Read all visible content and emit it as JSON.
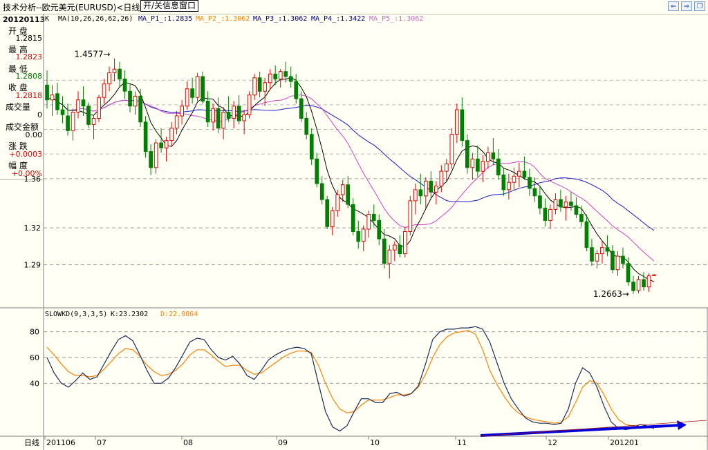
{
  "window": {
    "title": "技术分析--欧元美元(EURUSD)<日线>",
    "toggle_info_button": "开/关信息窗口"
  },
  "sidebar": {
    "date": "20120113",
    "rows": [
      {
        "label": "开  盘",
        "value": "1.2815",
        "color": "#000000"
      },
      {
        "label": "最  高",
        "value": "1.2823",
        "color": "#e60000"
      },
      {
        "label": "最  低",
        "value": "1.2808",
        "color": "#008000"
      },
      {
        "label": "收  盘",
        "value": "1.2818",
        "color": "#e60000"
      },
      {
        "label": "成交量",
        "value": "0",
        "color": "#000000"
      },
      {
        "label": "成交金额",
        "value": "0.00",
        "color": "#000000"
      },
      {
        "label": "涨  跌",
        "value": "+0.0003",
        "color": "#e60000"
      },
      {
        "label": "幅  度",
        "value": "+0.00%",
        "color": "#e60000"
      }
    ]
  },
  "main_legend": {
    "k": "K",
    "ma_params": "MA(10,26,26,62,26)",
    "items": [
      {
        "text": "MA_P1_:1.2835",
        "color": "#000080"
      },
      {
        "text": "MA_P2_:1.3062",
        "color": "#ff8000"
      },
      {
        "text": "MA_P3_:1.3062",
        "color": "#000080"
      },
      {
        "text": "MA_P4_:1.3422",
        "color": "#000080"
      },
      {
        "text": "MA_P5_:1.3062",
        "color": "#cc66cc"
      }
    ]
  },
  "kd_legend": {
    "name": "SLOWKD(9,3,3,5)",
    "k": "K:23.2302",
    "d": "D:22.0864"
  },
  "colors": {
    "up": "#e60000",
    "down": "#008000",
    "ma10": "#000000",
    "ma26_slow": "#1a1acc",
    "ma62_violet": "#cc44cc",
    "k_line": "#1a2a5a",
    "d_line": "#ff8000",
    "trend_arrow": "#0000dd"
  },
  "chart_data": [
    {
      "type": "candlestick",
      "ylabel_ticks": [
        "1.36",
        "1.32",
        "1.29"
      ],
      "ylim": [
        1.255,
        1.485
      ],
      "annotations": [
        {
          "text": "1.4577",
          "value": 1.4577,
          "label": "high"
        },
        {
          "text": "1.2663",
          "value": 1.2663,
          "label": "low"
        }
      ],
      "ohlc": [
        [
          1.436,
          1.448,
          1.417,
          1.424
        ],
        [
          1.424,
          1.436,
          1.411,
          1.428
        ],
        [
          1.429,
          1.438,
          1.412,
          1.416
        ],
        [
          1.416,
          1.427,
          1.405,
          1.412
        ],
        [
          1.411,
          1.421,
          1.395,
          1.399
        ],
        [
          1.399,
          1.417,
          1.391,
          1.414
        ],
        [
          1.414,
          1.431,
          1.409,
          1.424
        ],
        [
          1.424,
          1.435,
          1.411,
          1.419
        ],
        [
          1.419,
          1.422,
          1.401,
          1.404
        ],
        [
          1.404,
          1.412,
          1.392,
          1.409
        ],
        [
          1.409,
          1.428,
          1.406,
          1.426
        ],
        [
          1.426,
          1.441,
          1.421,
          1.437
        ],
        [
          1.437,
          1.451,
          1.431,
          1.446
        ],
        [
          1.446,
          1.4577,
          1.439,
          1.449
        ],
        [
          1.449,
          1.455,
          1.434,
          1.441
        ],
        [
          1.441,
          1.448,
          1.425,
          1.431
        ],
        [
          1.431,
          1.437,
          1.414,
          1.419
        ],
        [
          1.419,
          1.431,
          1.412,
          1.427
        ],
        [
          1.427,
          1.433,
          1.402,
          1.406
        ],
        [
          1.406,
          1.411,
          1.377,
          1.382
        ],
        [
          1.382,
          1.388,
          1.363,
          1.369
        ],
        [
          1.369,
          1.392,
          1.364,
          1.389
        ],
        [
          1.389,
          1.401,
          1.381,
          1.385
        ],
        [
          1.385,
          1.394,
          1.374,
          1.391
        ],
        [
          1.391,
          1.406,
          1.386,
          1.401
        ],
        [
          1.401,
          1.415,
          1.396,
          1.411
        ],
        [
          1.411,
          1.424,
          1.404,
          1.419
        ],
        [
          1.419,
          1.439,
          1.416,
          1.433
        ],
        [
          1.433,
          1.442,
          1.421,
          1.426
        ],
        [
          1.426,
          1.446,
          1.423,
          1.443
        ],
        [
          1.443,
          1.447,
          1.421,
          1.423
        ],
        [
          1.423,
          1.431,
          1.402,
          1.406
        ],
        [
          1.406,
          1.421,
          1.399,
          1.417
        ],
        [
          1.417,
          1.426,
          1.397,
          1.401
        ],
        [
          1.401,
          1.418,
          1.392,
          1.414
        ],
        [
          1.414,
          1.427,
          1.406,
          1.409
        ],
        [
          1.409,
          1.423,
          1.401,
          1.419
        ],
        [
          1.419,
          1.428,
          1.404,
          1.407
        ],
        [
          1.407,
          1.416,
          1.396,
          1.412
        ],
        [
          1.412,
          1.431,
          1.409,
          1.428
        ],
        [
          1.428,
          1.445,
          1.424,
          1.442
        ],
        [
          1.442,
          1.447,
          1.426,
          1.431
        ],
        [
          1.431,
          1.442,
          1.419,
          1.438
        ],
        [
          1.438,
          1.449,
          1.432,
          1.445
        ],
        [
          1.445,
          1.452,
          1.436,
          1.441
        ],
        [
          1.441,
          1.449,
          1.434,
          1.447
        ],
        [
          1.447,
          1.455,
          1.438,
          1.443
        ],
        [
          1.443,
          1.451,
          1.434,
          1.439
        ],
        [
          1.439,
          1.445,
          1.421,
          1.425
        ],
        [
          1.425,
          1.431,
          1.406,
          1.409
        ],
        [
          1.409,
          1.414,
          1.392,
          1.396
        ],
        [
          1.396,
          1.401,
          1.371,
          1.376
        ],
        [
          1.376,
          1.381,
          1.353,
          1.356
        ],
        [
          1.356,
          1.362,
          1.339,
          1.343
        ],
        [
          1.343,
          1.346,
          1.319,
          1.321
        ],
        [
          1.321,
          1.337,
          1.314,
          1.334
        ],
        [
          1.334,
          1.351,
          1.329,
          1.347
        ],
        [
          1.347,
          1.359,
          1.341,
          1.355
        ],
        [
          1.355,
          1.362,
          1.336,
          1.339
        ],
        [
          1.339,
          1.344,
          1.314,
          1.317
        ],
        [
          1.317,
          1.326,
          1.303,
          1.309
        ],
        [
          1.309,
          1.322,
          1.301,
          1.319
        ],
        [
          1.319,
          1.334,
          1.312,
          1.331
        ],
        [
          1.331,
          1.339,
          1.321,
          1.326
        ],
        [
          1.326,
          1.331,
          1.306,
          1.311
        ],
        [
          1.311,
          1.319,
          1.287,
          1.291
        ],
        [
          1.291,
          1.306,
          1.279,
          1.302
        ],
        [
          1.302,
          1.309,
          1.293,
          1.306
        ],
        [
          1.306,
          1.314,
          1.296,
          1.299
        ],
        [
          1.299,
          1.321,
          1.296,
          1.317
        ],
        [
          1.317,
          1.346,
          1.314,
          1.342
        ],
        [
          1.342,
          1.356,
          1.331,
          1.351
        ],
        [
          1.351,
          1.364,
          1.339,
          1.346
        ],
        [
          1.346,
          1.361,
          1.336,
          1.358
        ],
        [
          1.358,
          1.366,
          1.343,
          1.349
        ],
        [
          1.349,
          1.358,
          1.339,
          1.354
        ],
        [
          1.354,
          1.371,
          1.349,
          1.366
        ],
        [
          1.366,
          1.376,
          1.358,
          1.372
        ],
        [
          1.372,
          1.401,
          1.368,
          1.396
        ],
        [
          1.396,
          1.421,
          1.389,
          1.416
        ],
        [
          1.416,
          1.426,
          1.386,
          1.391
        ],
        [
          1.391,
          1.396,
          1.364,
          1.369
        ],
        [
          1.369,
          1.381,
          1.359,
          1.376
        ],
        [
          1.376,
          1.387,
          1.361,
          1.366
        ],
        [
          1.366,
          1.379,
          1.357,
          1.374
        ],
        [
          1.374,
          1.386,
          1.368,
          1.381
        ],
        [
          1.381,
          1.393,
          1.371,
          1.376
        ],
        [
          1.376,
          1.384,
          1.359,
          1.363
        ],
        [
          1.363,
          1.369,
          1.346,
          1.351
        ],
        [
          1.351,
          1.364,
          1.343,
          1.357
        ],
        [
          1.357,
          1.369,
          1.351,
          1.362
        ],
        [
          1.362,
          1.373,
          1.353,
          1.366
        ],
        [
          1.366,
          1.378,
          1.359,
          1.361
        ],
        [
          1.361,
          1.368,
          1.346,
          1.352
        ],
        [
          1.352,
          1.361,
          1.341,
          1.346
        ],
        [
          1.346,
          1.354,
          1.331,
          1.336
        ],
        [
          1.336,
          1.344,
          1.321,
          1.326
        ],
        [
          1.326,
          1.339,
          1.319,
          1.335
        ],
        [
          1.335,
          1.348,
          1.331,
          1.343
        ],
        [
          1.343,
          1.351,
          1.333,
          1.337
        ],
        [
          1.337,
          1.346,
          1.326,
          1.341
        ],
        [
          1.341,
          1.349,
          1.334,
          1.338
        ],
        [
          1.338,
          1.345,
          1.328,
          1.331
        ],
        [
          1.331,
          1.338,
          1.321,
          1.325
        ],
        [
          1.325,
          1.331,
          1.301,
          1.304
        ],
        [
          1.304,
          1.311,
          1.289,
          1.293
        ],
        [
          1.293,
          1.302,
          1.287,
          1.299
        ],
        [
          1.299,
          1.309,
          1.291,
          1.304
        ],
        [
          1.304,
          1.314,
          1.297,
          1.301
        ],
        [
          1.301,
          1.306,
          1.283,
          1.286
        ],
        [
          1.286,
          1.301,
          1.281,
          1.297
        ],
        [
          1.297,
          1.304,
          1.287,
          1.291
        ],
        [
          1.291,
          1.296,
          1.273,
          1.276
        ],
        [
          1.276,
          1.281,
          1.2663,
          1.269
        ],
        [
          1.269,
          1.281,
          1.267,
          1.278
        ],
        [
          1.278,
          1.284,
          1.269,
          1.272
        ],
        [
          1.272,
          1.283,
          1.268,
          1.281
        ],
        [
          1.2815,
          1.2823,
          1.2808,
          1.2818
        ]
      ]
    },
    {
      "type": "line",
      "name": "SLOWKD(9,3,3,5)",
      "ylabel_ticks": [
        "80",
        "60",
        "40"
      ],
      "ylim": [
        0,
        90
      ],
      "k": [
        60,
        48,
        40,
        37,
        42,
        48,
        43,
        45,
        55,
        65,
        74,
        77,
        73,
        62,
        50,
        40,
        40,
        44,
        52,
        62,
        72,
        75,
        74,
        66,
        60,
        58,
        61,
        55,
        46,
        43,
        50,
        58,
        62,
        65,
        67,
        68,
        67,
        63,
        40,
        18,
        6,
        3,
        7,
        18,
        28,
        28,
        25,
        25,
        32,
        33,
        30,
        32,
        38,
        55,
        74,
        80,
        82,
        82,
        83,
        83,
        84,
        82,
        72,
        56,
        40,
        28,
        20,
        13,
        10,
        9,
        9,
        8,
        9,
        20,
        40,
        52,
        48,
        37,
        22,
        10,
        5,
        4,
        5,
        8,
        7,
        5
      ],
      "d": [
        68,
        62,
        55,
        49,
        46,
        46,
        45,
        46,
        51,
        57,
        63,
        67,
        66,
        61,
        54,
        49,
        46,
        47,
        50,
        55,
        62,
        66,
        66,
        62,
        57,
        53,
        54,
        54,
        50,
        47,
        48,
        52,
        56,
        60,
        63,
        65,
        65,
        64,
        54,
        40,
        28,
        20,
        17,
        18,
        23,
        27,
        27,
        27,
        29,
        31,
        31,
        32,
        37,
        47,
        60,
        70,
        76,
        79,
        80,
        81,
        78,
        66,
        50,
        39,
        30,
        22,
        17,
        14,
        12,
        11,
        10,
        9,
        10,
        14,
        25,
        37,
        42,
        40,
        31,
        20,
        12,
        8,
        7,
        6,
        6,
        5
      ]
    }
  ],
  "xaxis": {
    "label": "日线",
    "ticks": [
      "201106",
      "07",
      "08",
      "09",
      "10",
      "11",
      "12",
      "201201"
    ]
  }
}
